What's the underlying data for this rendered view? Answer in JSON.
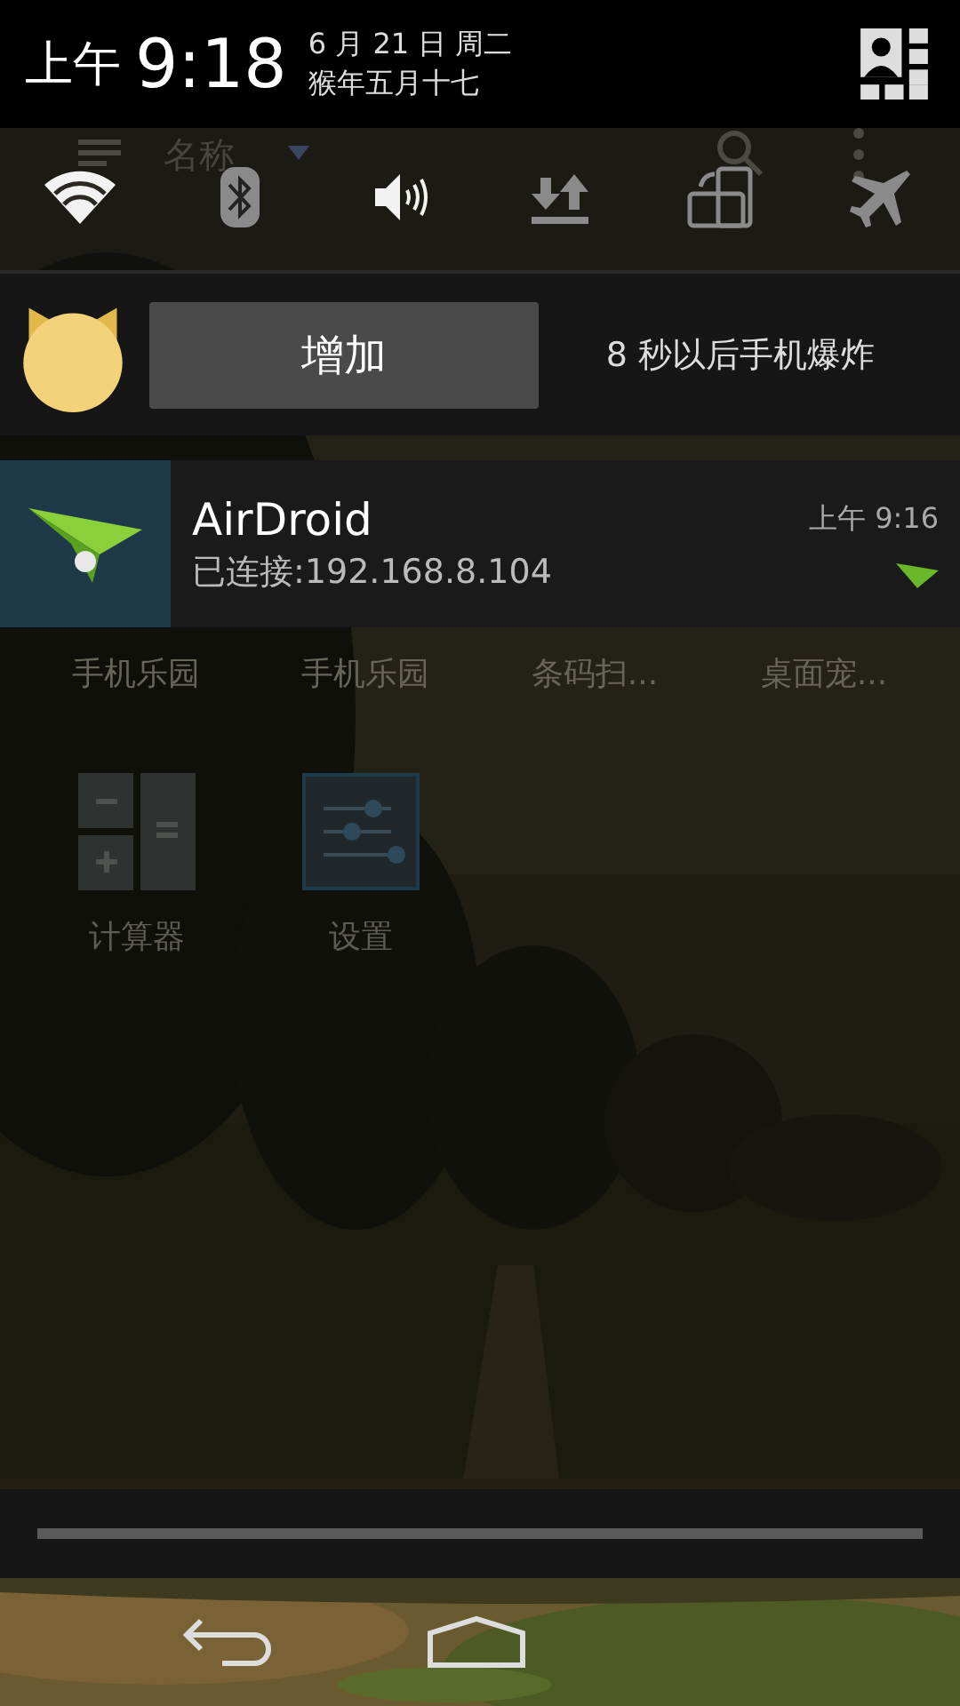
{
  "status_header": {
    "period": "上午",
    "time": "9:18",
    "date": "6 月 21 日 周二",
    "lunar_date": "猴年五月十七"
  },
  "background_app_bar": {
    "title": "名称"
  },
  "quick_settings": [
    {
      "kind": "wifi",
      "on": true
    },
    {
      "kind": "bluetooth",
      "on": false
    },
    {
      "kind": "sound",
      "on": true
    },
    {
      "kind": "data",
      "on": false
    },
    {
      "kind": "rotation",
      "on": false
    },
    {
      "kind": "airplane",
      "on": false
    }
  ],
  "notifications": [
    {
      "kind": "action",
      "button": "增加",
      "text": "8 秒以后手机爆炸"
    },
    {
      "kind": "app",
      "title": "AirDroid",
      "text": "已连接:192.168.8.104",
      "time": "上午 9:16"
    }
  ],
  "home_screen": {
    "folders": [
      "手机乐园",
      "手机乐园",
      "条码扫...",
      "桌面宠..."
    ],
    "apps": [
      {
        "kind": "calculator",
        "label": "计算器"
      },
      {
        "kind": "settings",
        "label": "设置"
      }
    ]
  }
}
